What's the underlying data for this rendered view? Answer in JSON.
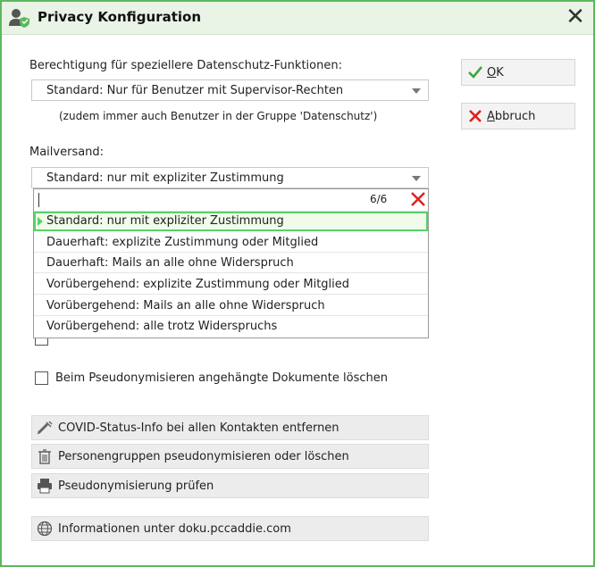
{
  "window": {
    "title": "Privacy Konfiguration",
    "close": "✕"
  },
  "permissions": {
    "label": "Berechtigung für speziellere Datenschutz-Funktionen:",
    "value": "Standard: Nur für Benutzer mit Supervisor-Rechten",
    "note": "(zudem immer auch Benutzer in der Gruppe 'Datenschutz')"
  },
  "mail": {
    "label": "Mailversand:",
    "value": "Standard: nur mit expliziter Zustimmung",
    "dropdown": {
      "count": "6/6",
      "items": [
        "Standard: nur mit expliziter Zustimmung",
        "Dauerhaft: explizite Zustimmung oder Mitglied",
        "Dauerhaft: Mails an alle ohne Widerspruch",
        "Vorübergehend: explizite Zustimmung oder Mitglied",
        "Vorübergehend: Mails an alle ohne Widerspruch",
        "Vorübergehend: alle trotz Widerspruchs"
      ]
    }
  },
  "checkbox_delete_docs": {
    "label": "Beim Pseudonymisieren angehängte Dokumente löschen",
    "checked": false
  },
  "actions": {
    "covid": "COVID-Status-Info bei allen Kontakten entfernen",
    "groups": "Personengruppen pseudonymisieren oder löschen",
    "check": "Pseudonymisierung prüfen",
    "info": "Informationen unter doku.pccaddie.com"
  },
  "buttons": {
    "ok_prefix": "O",
    "ok_rest": "K",
    "cancel_prefix": "A",
    "cancel_rest": "bbruch"
  },
  "icons": {
    "title": "user-shield-icon",
    "ok": "check-icon",
    "cancel": "x-icon",
    "dd_clear": "clear-x-icon",
    "covid": "syringe-icon",
    "groups": "trash-icon",
    "check": "printer-icon",
    "info": "globe-icon"
  },
  "colors": {
    "accent": "#5cb85c",
    "title_bg": "#e9f4e6",
    "selected_border": "#57d16b",
    "danger": "#e02020"
  }
}
